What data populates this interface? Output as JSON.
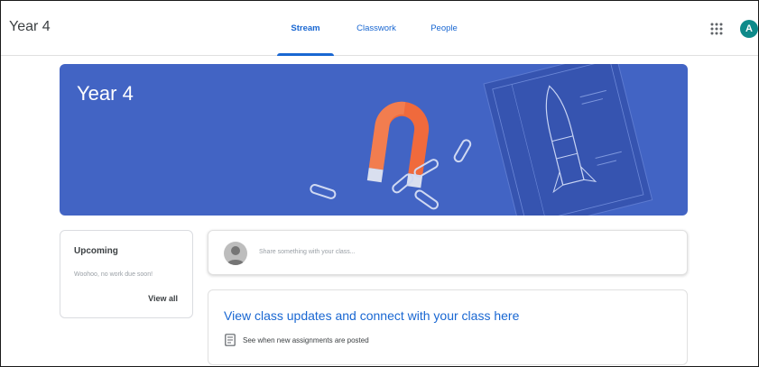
{
  "header": {
    "class_title": "Year 4",
    "tabs": [
      {
        "label": "Stream",
        "active": true
      },
      {
        "label": "Classwork",
        "active": false
      },
      {
        "label": "People",
        "active": false
      }
    ],
    "apps_icon": "grid-apps-icon",
    "avatar_initial": "A"
  },
  "banner": {
    "title": "Year 4",
    "color": "#4264c4",
    "illustration": "magnet-paperclips-rocket-blueprint"
  },
  "upcoming": {
    "title": "Upcoming",
    "message": "Woohoo, no work due soon!",
    "link": "View all"
  },
  "share": {
    "placeholder": "Share something with your class..."
  },
  "updates": {
    "title": "View class updates and connect with your class here",
    "subtitle": "See when new assignments are posted",
    "icon": "assignment-icon"
  },
  "colors": {
    "accent": "#1967d2",
    "avatar": "#0e8a8a"
  }
}
